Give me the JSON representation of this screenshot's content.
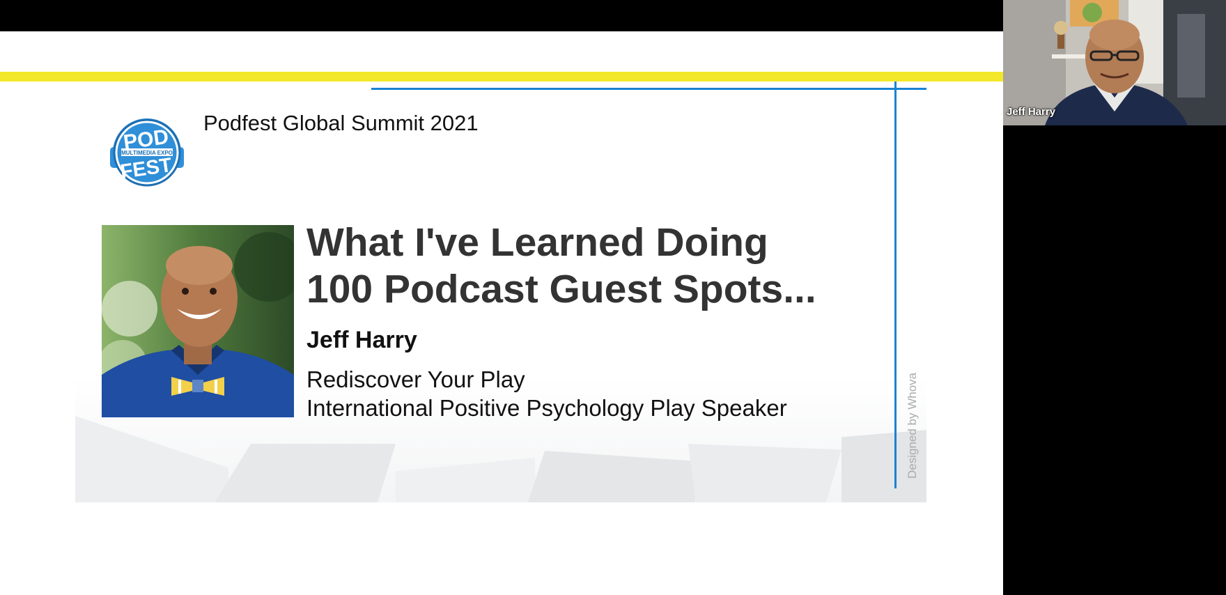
{
  "slide": {
    "event_title": "Podfest Global Summit 2021",
    "talk_title_line1": "What I've Learned Doing",
    "talk_title_line2": "100 Podcast Guest Spots...",
    "speaker_name": "Jeff Harry",
    "tagline_1": "Rediscover Your Play",
    "tagline_2": "International Positive Psychology Play Speaker",
    "credit": "Designed by Whova",
    "logo": {
      "top_text": "POD",
      "ring_text": "MULTIMEDIA EXPO",
      "bottom_text": "FEST",
      "icon": "podfest-headphones-logo"
    }
  },
  "video": {
    "participant_name": "Jeff Harry"
  },
  "colors": {
    "accent_yellow": "#f4e82a",
    "accent_blue": "#1b82d1",
    "logo_blue": "#2f8fd8"
  }
}
